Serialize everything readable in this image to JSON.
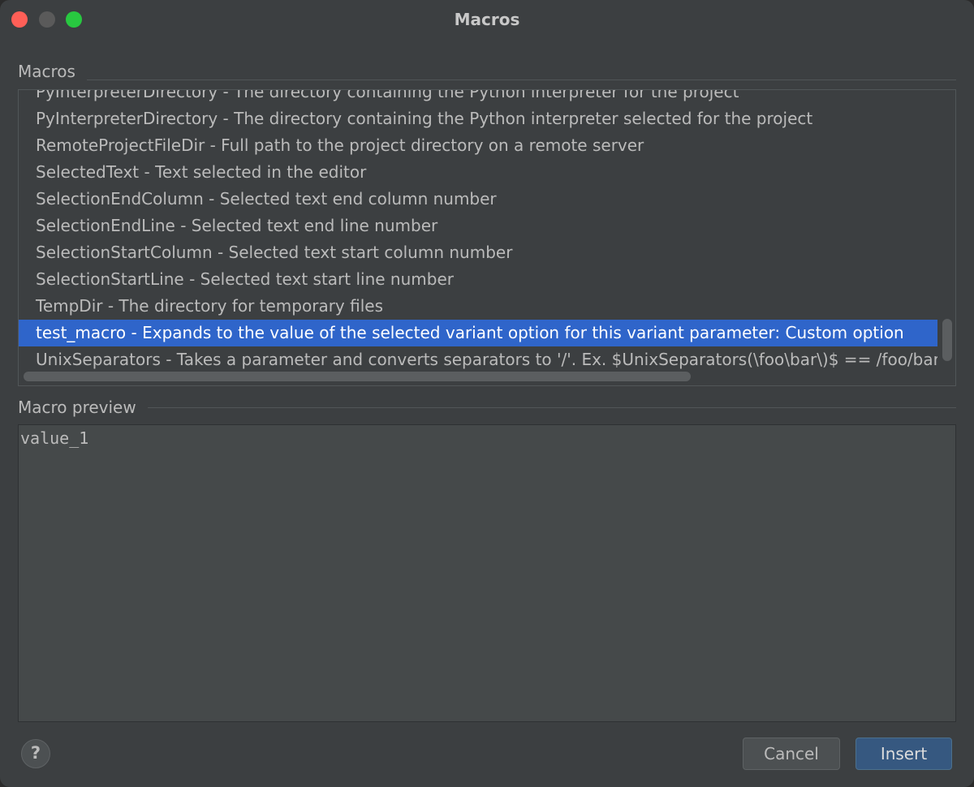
{
  "window": {
    "title": "Macros"
  },
  "macros_section": {
    "label": "Macros",
    "items": [
      {
        "text": "PyInterpreterDirectory - The directory containing the Python interpreter for the project",
        "selected": false
      },
      {
        "text": "PyInterpreterDirectory - The directory containing the Python interpreter selected for the project",
        "selected": false
      },
      {
        "text": "RemoteProjectFileDir - Full path to the project directory on a remote server",
        "selected": false
      },
      {
        "text": "SelectedText - Text selected in the editor",
        "selected": false
      },
      {
        "text": "SelectionEndColumn - Selected text end column number",
        "selected": false
      },
      {
        "text": "SelectionEndLine - Selected text end line number",
        "selected": false
      },
      {
        "text": "SelectionStartColumn - Selected text start column number",
        "selected": false
      },
      {
        "text": "SelectionStartLine - Selected text start line number",
        "selected": false
      },
      {
        "text": "TempDir - The directory for temporary files",
        "selected": false
      },
      {
        "text": "test_macro - Expands to the value of the selected variant option for this variant parameter: Custom option",
        "selected": true
      },
      {
        "text": "UnixSeparators - Takes a parameter and converts separators to '/'. Ex. $UnixSeparators(\\foo\\bar\\)$ == /foo/bar/",
        "selected": false
      }
    ]
  },
  "preview_section": {
    "label": "Macro preview",
    "value": "value_1"
  },
  "buttons": {
    "help": "?",
    "cancel": "Cancel",
    "insert": "Insert"
  },
  "colors": {
    "selection": "#2f65ca",
    "background": "#3c3f41",
    "close": "#ff5f57",
    "maximize": "#28c840"
  }
}
